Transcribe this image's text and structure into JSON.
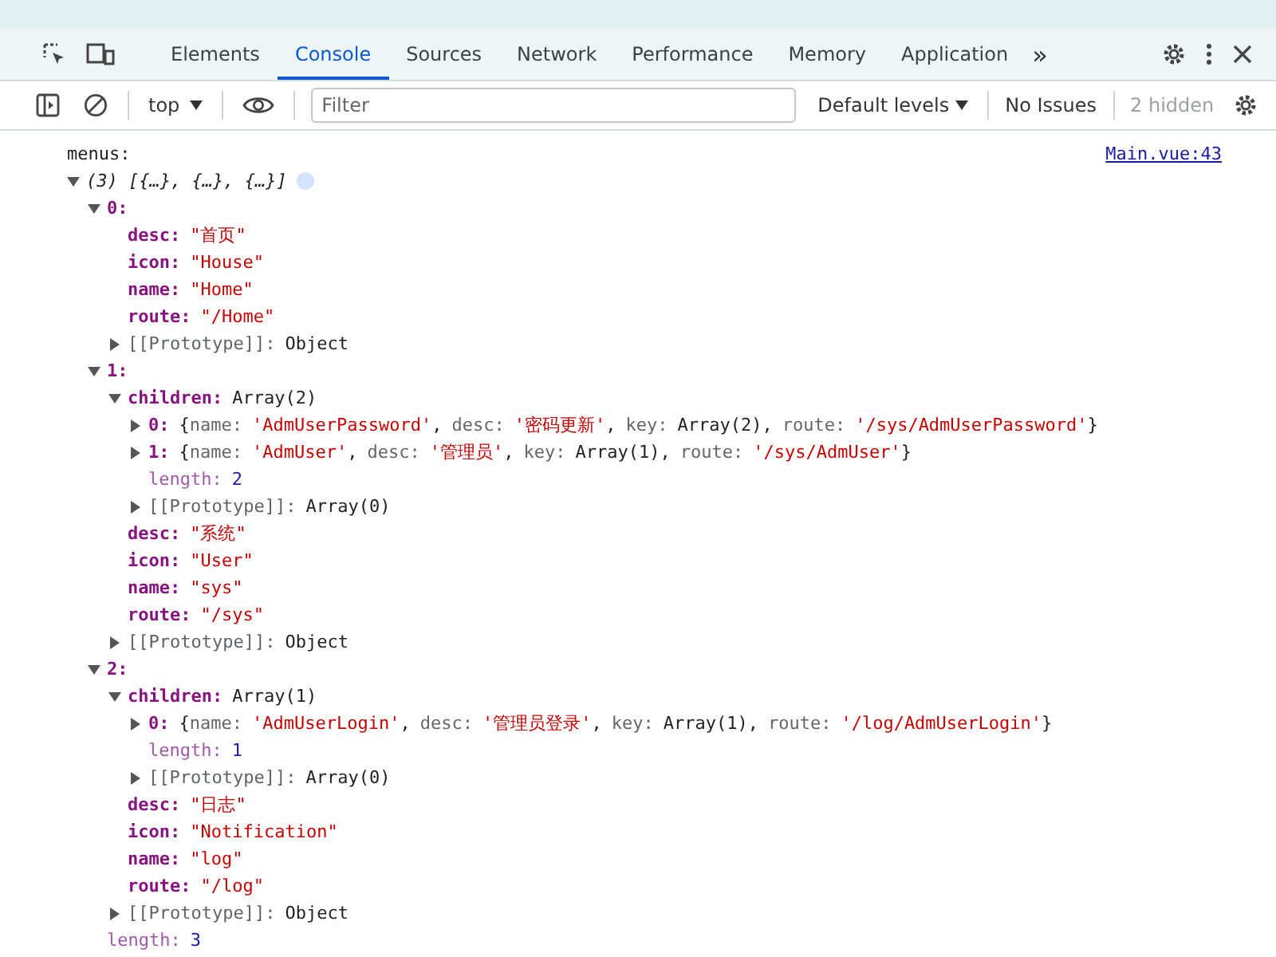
{
  "tabs": [
    {
      "label": "Elements",
      "selected": false
    },
    {
      "label": "Console",
      "selected": true
    },
    {
      "label": "Sources",
      "selected": false
    },
    {
      "label": "Network",
      "selected": false
    },
    {
      "label": "Performance",
      "selected": false
    },
    {
      "label": "Memory",
      "selected": false
    },
    {
      "label": "Application",
      "selected": false
    }
  ],
  "more_tabs": "»",
  "console_toolbar": {
    "context": "top",
    "filter": {
      "placeholder": "Filter"
    },
    "levels": "Default levels",
    "issues": "No Issues",
    "hidden": "2 hidden"
  },
  "log": {
    "label": "menus:",
    "source": "Main.vue:43",
    "tree": {
      "value": {
        "text": "(3) [{…}, {…}, {…}]",
        "kind": "summary"
      },
      "expanded": true,
      "children": [
        {
          "key": {
            "text": "0:",
            "kind": "own"
          },
          "expanded": true,
          "children": [
            {
              "key": {
                "text": "desc:",
                "kind": "own"
              },
              "value": {
                "text": "\"首页\"",
                "kind": "string"
              }
            },
            {
              "key": {
                "text": "icon:",
                "kind": "own"
              },
              "value": {
                "text": "\"House\"",
                "kind": "string"
              }
            },
            {
              "key": {
                "text": "name:",
                "kind": "own"
              },
              "value": {
                "text": "\"Home\"",
                "kind": "string"
              }
            },
            {
              "key": {
                "text": "route:",
                "kind": "own"
              },
              "value": {
                "text": "\"/Home\"",
                "kind": "string"
              }
            },
            {
              "key": {
                "text": "[[Prototype]]:",
                "kind": "internal"
              },
              "value": {
                "text": "Object",
                "kind": "plain"
              },
              "expanded": false
            }
          ]
        },
        {
          "key": {
            "text": "1:",
            "kind": "own"
          },
          "expanded": true,
          "children": [
            {
              "key": {
                "text": "children:",
                "kind": "own"
              },
              "value": {
                "text": "Array(2)",
                "kind": "plain"
              },
              "expanded": true,
              "children": [
                {
                  "key": {
                    "text": "0:",
                    "kind": "own"
                  },
                  "expanded": false,
                  "parts": [
                    {
                      "text": "{",
                      "kind": "plain"
                    },
                    {
                      "text": "name:",
                      "kind": "dim"
                    },
                    {
                      "text": "'AdmUserPassword'",
                      "kind": "string"
                    },
                    {
                      "text": ",",
                      "kind": "plain"
                    },
                    {
                      "text": "desc:",
                      "kind": "dim"
                    },
                    {
                      "text": "'密码更新'",
                      "kind": "string"
                    },
                    {
                      "text": ",",
                      "kind": "plain"
                    },
                    {
                      "text": "key:",
                      "kind": "dim"
                    },
                    {
                      "text": "Array(2)",
                      "kind": "plain"
                    },
                    {
                      "text": ",",
                      "kind": "plain"
                    },
                    {
                      "text": "route:",
                      "kind": "dim"
                    },
                    {
                      "text": "'/sys/AdmUserPassword'",
                      "kind": "string"
                    },
                    {
                      "text": "}",
                      "kind": "plain"
                    }
                  ]
                },
                {
                  "key": {
                    "text": "1:",
                    "kind": "own"
                  },
                  "expanded": false,
                  "parts": [
                    {
                      "text": "{",
                      "kind": "plain"
                    },
                    {
                      "text": "name:",
                      "kind": "dim"
                    },
                    {
                      "text": "'AdmUser'",
                      "kind": "string"
                    },
                    {
                      "text": ",",
                      "kind": "plain"
                    },
                    {
                      "text": "desc:",
                      "kind": "dim"
                    },
                    {
                      "text": "'管理员'",
                      "kind": "string"
                    },
                    {
                      "text": ",",
                      "kind": "plain"
                    },
                    {
                      "text": "key:",
                      "kind": "dim"
                    },
                    {
                      "text": "Array(1)",
                      "kind": "plain"
                    },
                    {
                      "text": ",",
                      "kind": "plain"
                    },
                    {
                      "text": "route:",
                      "kind": "dim"
                    },
                    {
                      "text": "'/sys/AdmUser'",
                      "kind": "string"
                    },
                    {
                      "text": "}",
                      "kind": "plain"
                    }
                  ]
                },
                {
                  "key": {
                    "text": "length:",
                    "kind": "hidden"
                  },
                  "value": {
                    "text": "2",
                    "kind": "number"
                  }
                },
                {
                  "key": {
                    "text": "[[Prototype]]:",
                    "kind": "internal"
                  },
                  "value": {
                    "text": "Array(0)",
                    "kind": "plain"
                  },
                  "expanded": false
                }
              ]
            },
            {
              "key": {
                "text": "desc:",
                "kind": "own"
              },
              "value": {
                "text": "\"系统\"",
                "kind": "string"
              }
            },
            {
              "key": {
                "text": "icon:",
                "kind": "own"
              },
              "value": {
                "text": "\"User\"",
                "kind": "string"
              }
            },
            {
              "key": {
                "text": "name:",
                "kind": "own"
              },
              "value": {
                "text": "\"sys\"",
                "kind": "string"
              }
            },
            {
              "key": {
                "text": "route:",
                "kind": "own"
              },
              "value": {
                "text": "\"/sys\"",
                "kind": "string"
              }
            },
            {
              "key": {
                "text": "[[Prototype]]:",
                "kind": "internal"
              },
              "value": {
                "text": "Object",
                "kind": "plain"
              },
              "expanded": false
            }
          ]
        },
        {
          "key": {
            "text": "2:",
            "kind": "own"
          },
          "expanded": true,
          "children": [
            {
              "key": {
                "text": "children:",
                "kind": "own"
              },
              "value": {
                "text": "Array(1)",
                "kind": "plain"
              },
              "expanded": true,
              "children": [
                {
                  "key": {
                    "text": "0:",
                    "kind": "own"
                  },
                  "expanded": false,
                  "parts": [
                    {
                      "text": "{",
                      "kind": "plain"
                    },
                    {
                      "text": "name:",
                      "kind": "dim"
                    },
                    {
                      "text": "'AdmUserLogin'",
                      "kind": "string"
                    },
                    {
                      "text": ",",
                      "kind": "plain"
                    },
                    {
                      "text": "desc:",
                      "kind": "dim"
                    },
                    {
                      "text": "'管理员登录'",
                      "kind": "string"
                    },
                    {
                      "text": ",",
                      "kind": "plain"
                    },
                    {
                      "text": "key:",
                      "kind": "dim"
                    },
                    {
                      "text": "Array(1)",
                      "kind": "plain"
                    },
                    {
                      "text": ",",
                      "kind": "plain"
                    },
                    {
                      "text": "route:",
                      "kind": "dim"
                    },
                    {
                      "text": "'/log/AdmUserLogin'",
                      "kind": "string"
                    },
                    {
                      "text": "}",
                      "kind": "plain"
                    }
                  ]
                },
                {
                  "key": {
                    "text": "length:",
                    "kind": "hidden"
                  },
                  "value": {
                    "text": "1",
                    "kind": "number"
                  }
                },
                {
                  "key": {
                    "text": "[[Prototype]]:",
                    "kind": "internal"
                  },
                  "value": {
                    "text": "Array(0)",
                    "kind": "plain"
                  },
                  "expanded": false
                }
              ]
            },
            {
              "key": {
                "text": "desc:",
                "kind": "own"
              },
              "value": {
                "text": "\"日志\"",
                "kind": "string"
              }
            },
            {
              "key": {
                "text": "icon:",
                "kind": "own"
              },
              "value": {
                "text": "\"Notification\"",
                "kind": "string"
              }
            },
            {
              "key": {
                "text": "name:",
                "kind": "own"
              },
              "value": {
                "text": "\"log\"",
                "kind": "string"
              }
            },
            {
              "key": {
                "text": "route:",
                "kind": "own"
              },
              "value": {
                "text": "\"/log\"",
                "kind": "string"
              }
            },
            {
              "key": {
                "text": "[[Prototype]]:",
                "kind": "internal"
              },
              "value": {
                "text": "Object",
                "kind": "plain"
              },
              "expanded": false
            }
          ]
        },
        {
          "key": {
            "text": "length:",
            "kind": "hidden"
          },
          "value": {
            "text": "3",
            "kind": "number"
          }
        }
      ]
    }
  }
}
